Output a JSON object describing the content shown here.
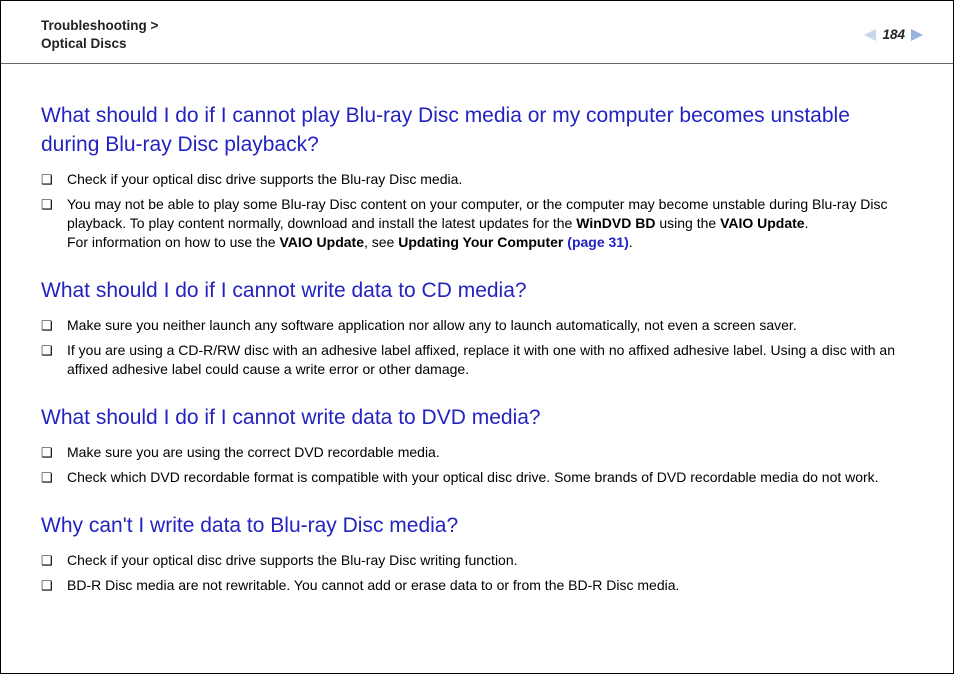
{
  "header": {
    "breadcrumb_line1": "Troubleshooting >",
    "breadcrumb_line2": "Optical Discs",
    "page_number": "184"
  },
  "sections": [
    {
      "title": "What should I do if I cannot play Blu-ray Disc media or my computer becomes unstable during Blu-ray Disc playback?",
      "items": [
        {
          "pre": "Check if your optical disc drive supports the Blu-ray Disc media."
        },
        {
          "pre": "You may not be able to play some Blu-ray Disc content on your computer, or the computer may become unstable during Blu-ray Disc playback. To play content normally, download and install the latest updates for the ",
          "b1": "WinDVD BD",
          "mid1": " using the ",
          "b2": "VAIO Update",
          "mid2": ".",
          "br": true,
          "post1": "For information on how to use the ",
          "b3": "VAIO Update",
          "post2": ", see ",
          "b4": "Updating Your Computer ",
          "link": "(page 31)",
          "post3": "."
        }
      ]
    },
    {
      "title": "What should I do if I cannot write data to CD media?",
      "items": [
        {
          "pre": "Make sure you neither launch any software application nor allow any to launch automatically, not even a screen saver."
        },
        {
          "pre": "If you are using a CD-R/RW disc with an adhesive label affixed, replace it with one with no affixed adhesive label. Using a disc with an affixed adhesive label could cause a write error or other damage."
        }
      ]
    },
    {
      "title": "What should I do if I cannot write data to DVD media?",
      "items": [
        {
          "pre": "Make sure you are using the correct DVD recordable media."
        },
        {
          "pre": "Check which DVD recordable format is compatible with your optical disc drive. Some brands of DVD recordable media do not work."
        }
      ]
    },
    {
      "title": "Why can't I write data to Blu-ray Disc media?",
      "items": [
        {
          "pre": "Check if your optical disc drive supports the Blu-ray Disc writing function."
        },
        {
          "pre": "BD-R Disc media are not rewritable. You cannot add or erase data to or from the BD-R Disc media."
        }
      ]
    }
  ]
}
